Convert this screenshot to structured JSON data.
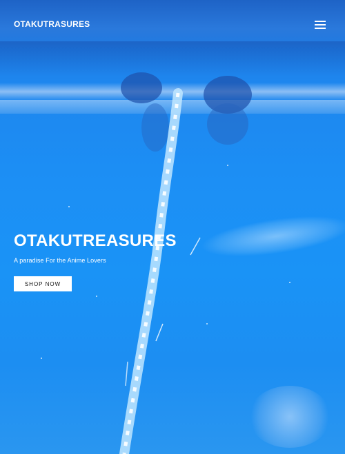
{
  "header": {
    "brand": "OTAKUTRASURES",
    "menu_icon": "hamburger-menu-icon"
  },
  "hero": {
    "title": "OTAKUTREASURES",
    "subtitle": "A paradise For the Anime Lovers",
    "cta_label": "SHOP NOW"
  },
  "colors": {
    "sky": "#1a8ff0",
    "text": "#ffffff",
    "button_bg": "#ffffff",
    "button_text": "#111111"
  }
}
